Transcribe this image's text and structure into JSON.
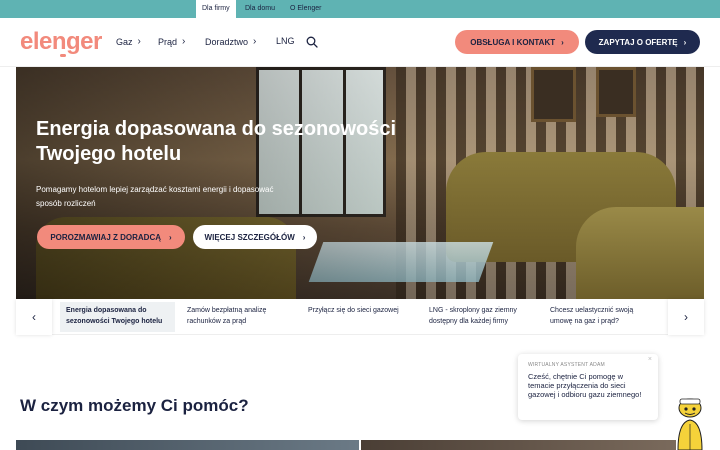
{
  "topbar": {
    "tabs": [
      {
        "label": "Dla firmy",
        "active": true
      },
      {
        "label": "Dla domu",
        "active": false
      },
      {
        "label": "O Elenger",
        "active": false
      }
    ]
  },
  "header": {
    "logo": "elenger",
    "nav": [
      {
        "label": "Gaz",
        "icon": "chevron-right-icon"
      },
      {
        "label": "Prąd",
        "icon": "chevron-right-icon"
      },
      {
        "label": "Doradztwo",
        "icon": "chevron-right-icon"
      },
      {
        "label": "LNG"
      }
    ],
    "search_icon": "search-icon",
    "service_button": "OBSŁUGA I KONTAKT",
    "offer_button": "ZAPYTAJ O OFERTĘ"
  },
  "hero": {
    "title": "Energia dopasowana do sezonowości Twojego hotelu",
    "subtitle": "Pomagamy hotelom lepiej zarządzać kosztami energii i dopasować sposób rozliczeń",
    "advisor_button": "POROZMAWIAJ Z DORADCĄ",
    "more_button": "WIĘCEJ SZCZEGÓŁÓW"
  },
  "carousel": {
    "items": [
      {
        "label": "Energia dopasowana do sezonowości Twojego hotelu",
        "active": true
      },
      {
        "label": "Zamów bezpłatną analizę rachunków za prąd",
        "active": false
      },
      {
        "label": "Przyłącz się do sieci gazowej",
        "active": false
      },
      {
        "label": "LNG - skroplony gaz ziemny dostępny dla każdej firmy",
        "active": false
      },
      {
        "label": "Chcesz uelastycznić swoją umowę na gaz i prąd?",
        "active": false
      }
    ]
  },
  "section": {
    "title": "W czym możemy Ci pomóc?"
  },
  "chat": {
    "label": "WIRTUALNY ASYSTENT ADAM",
    "message": "Cześć, chętnie Ci pomogę w temacie przyłączenia do sieci gazowej i odbioru gazu ziemnego!",
    "close": "×"
  },
  "colors": {
    "accent": "#f28a7c",
    "navy": "#1f2a4f",
    "topbar": "#5fb3b3"
  }
}
